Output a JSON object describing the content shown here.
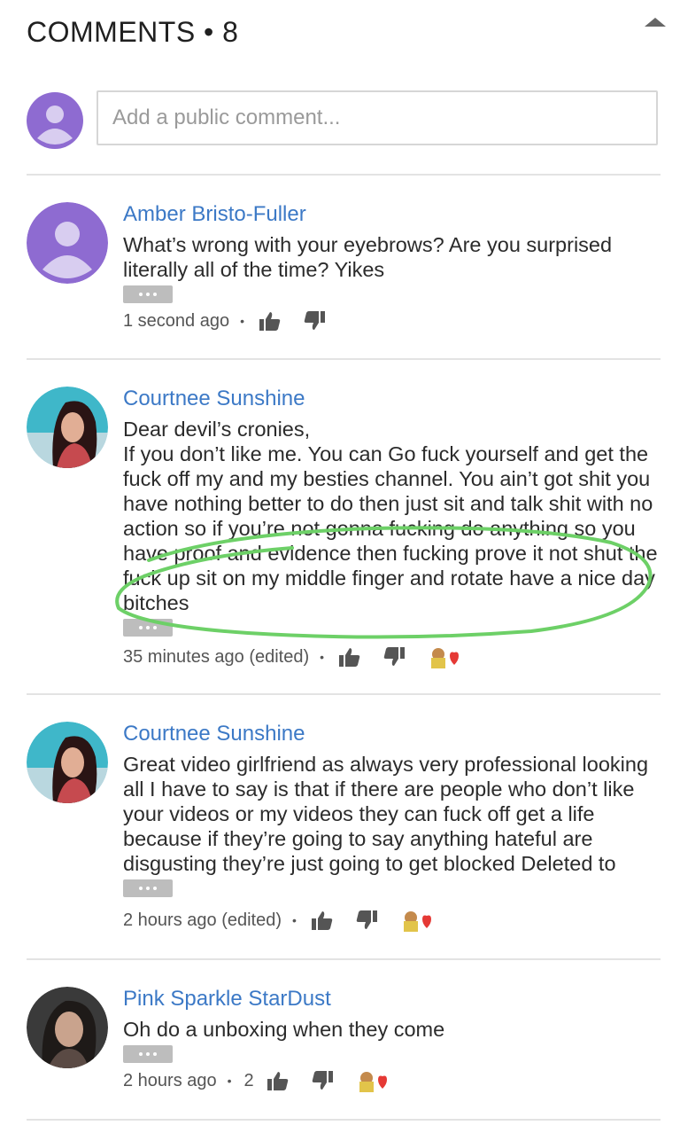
{
  "header": {
    "title": "COMMENTS • 8"
  },
  "compose": {
    "placeholder": "Add a public comment..."
  },
  "comments": [
    {
      "author": "Amber Bristo-Fuller",
      "text": "What’s wrong with your eyebrows? Are you surprised literally all of the time? Yikes",
      "time": "1 second ago",
      "likes": "",
      "avatar": "default-avatar"
    },
    {
      "author": "Courtnee Sunshine",
      "text": "Dear devil’s cronies,\nIf you don’t like me. You can Go fuck yourself and get the fuck off my and my besties channel. You ain’t got shit you have nothing better to do then just sit and talk shit with no action so if you’re not gonna fucking do anything so you have proof and evidence then fucking prove it not shut the fuck up sit on my middle finger and rotate have a nice day bitches",
      "time": "35 minutes ago (edited)",
      "likes": "",
      "avatar": "user-photo"
    },
    {
      "author": "Courtnee Sunshine",
      "text": "Great video girlfriend as always very professional looking all I have to say is that if there are people who don’t like your videos or my videos they can fuck off get a life because if they’re going to say anything hateful are disgusting they’re just going to get blocked Deleted to",
      "time": "2 hours ago (edited)",
      "likes": "",
      "avatar": "user-photo"
    },
    {
      "author": "Pink Sparkle StarDust",
      "text": "Oh do a unboxing when they come",
      "time": "2 hours ago",
      "likes": "2",
      "avatar": "user-photo"
    }
  ],
  "colors": {
    "author_link": "#3c79c6",
    "default_avatar": "#8e6bd1",
    "annotation_circle": "#6dd067"
  },
  "icons": [
    "collapse-arrow-icon",
    "thumb-up-icon",
    "thumb-down-icon",
    "creator-heart-icon",
    "more-options-icon"
  ]
}
